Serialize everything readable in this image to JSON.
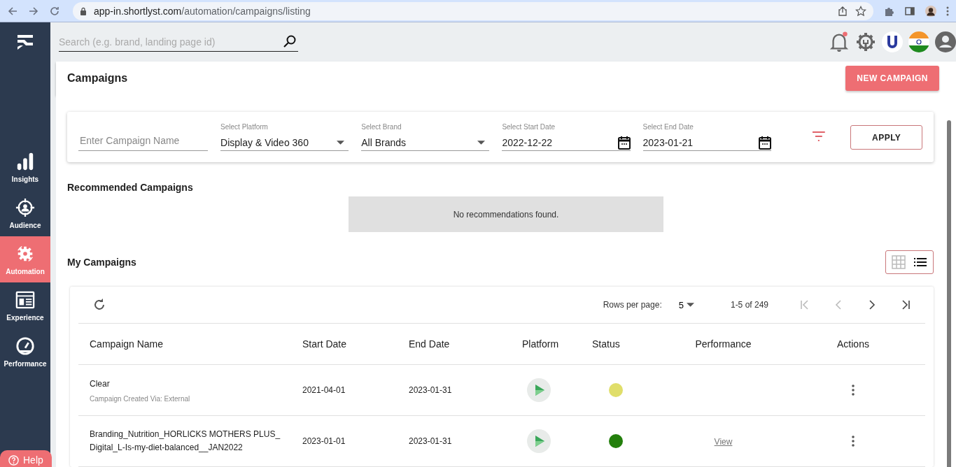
{
  "browser": {
    "url_host": "app-in.shortlyst.com",
    "url_path": "/automation/campaigns/listing"
  },
  "search": {
    "placeholder": "Search (e.g. brand, landing page id)"
  },
  "sidebar": {
    "items": [
      {
        "label": "Insights",
        "kind": "bars",
        "selected": false
      },
      {
        "label": "Audience",
        "kind": "target",
        "selected": false
      },
      {
        "label": "Automation",
        "kind": "gear",
        "selected": true
      },
      {
        "label": "Experience",
        "kind": "page",
        "selected": false
      },
      {
        "label": "Performance",
        "kind": "gauge",
        "selected": false
      }
    ]
  },
  "help": {
    "label": "Help"
  },
  "header": {
    "title": "Campaigns",
    "button": "NEW CAMPAIGN"
  },
  "filters": {
    "name_placeholder": "Enter Campaign Name",
    "fields": [
      {
        "label": "Select Platform",
        "value": "Display & Video 360",
        "kind": "select"
      },
      {
        "label": "Select Brand",
        "value": "All Brands",
        "kind": "select"
      },
      {
        "label": "Select Start Date",
        "value": "2022-12-22",
        "kind": "date"
      },
      {
        "label": "Select End Date",
        "value": "2023-01-21",
        "kind": "date"
      }
    ],
    "apply": "APPLY"
  },
  "recommended": {
    "title": "Recommended Campaigns",
    "empty": "No recommendations found."
  },
  "my_campaigns": {
    "title": "My Campaigns",
    "views": [
      {
        "kind": "grid",
        "selected": false
      },
      {
        "kind": "list",
        "selected": true
      }
    ]
  },
  "table": {
    "rows_per_page_label": "Rows per page:",
    "rows_per_page": "5",
    "range": "1-5 of 249",
    "columns": [
      "Campaign Name",
      "Start Date",
      "End Date",
      "Platform",
      "Status",
      "Performance",
      "Actions"
    ],
    "rows": [
      {
        "name": "Clear",
        "subtitle": "Campaign Created Via: External",
        "start": "2021-04-01",
        "end": "2023-01-31",
        "color": "#e0de6a"
      },
      {
        "name": "Branding_Nutrition_HORLICKS MOTHERS PLUS_Digital_L-Is-my-diet-balanced__JAN2022",
        "start": "2023-01-01",
        "end": "2023-01-31",
        "color": "#237f0c",
        "performance": "View"
      }
    ]
  }
}
